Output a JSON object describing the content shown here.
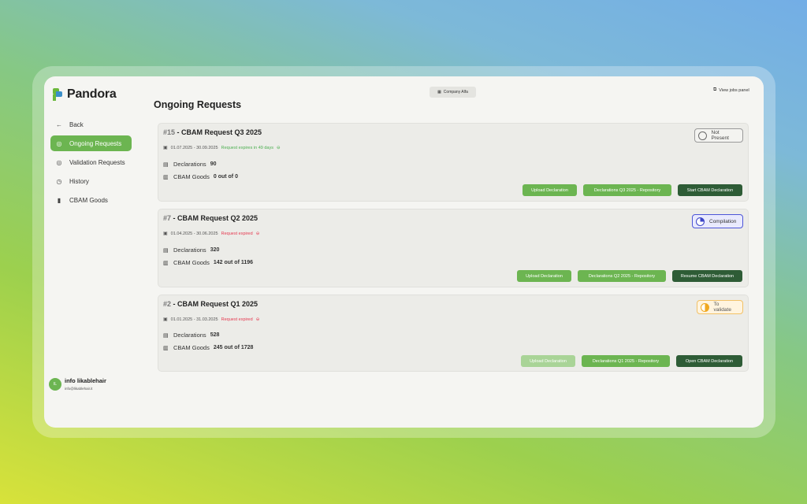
{
  "app": {
    "name": "Pandora"
  },
  "sidebar": {
    "items": [
      {
        "label": "Back",
        "icon": "arrow-left-icon",
        "active": false
      },
      {
        "label": "Ongoing Requests",
        "icon": "check-circle-icon",
        "active": true
      },
      {
        "label": "Validation Requests",
        "icon": "check-circle-icon",
        "active": false
      },
      {
        "label": "History",
        "icon": "history-icon",
        "active": false
      },
      {
        "label": "CBAM Goods",
        "icon": "book-icon",
        "active": false
      }
    ]
  },
  "user": {
    "initials": "IL",
    "name": "info likablehair",
    "email": "info@likablehair.it"
  },
  "header": {
    "company_button": "Company Alfa",
    "view_jobs": "View jobs panel"
  },
  "page": {
    "title": "Ongoing Requests"
  },
  "requests": [
    {
      "number": "#15",
      "title": "CBAM Request Q3 2025",
      "dates": "01.07.2025 - 30.09.2025",
      "expiry": "Request expires in 49 days",
      "expiry_color": "#4caf50",
      "declarations_label": "Declarations",
      "declarations": "90",
      "goods_label": "CBAM Goods",
      "goods": "0 out of 0",
      "status": "Not Present",
      "status_color": "#666666",
      "actions": [
        {
          "label": "Upload Declaration"
        },
        {
          "label": "Declarations Q3 2025 - Repository"
        },
        {
          "label": "Start CBAM Declaration"
        }
      ]
    },
    {
      "number": "#7",
      "title": "CBAM Request Q2 2025",
      "dates": "01.04.2025 - 30.06.2025",
      "expiry": "Request expired",
      "expiry_color": "#e53950",
      "declarations_label": "Declarations",
      "declarations": "320",
      "goods_label": "CBAM Goods",
      "goods": "142 out of 1196",
      "status": "Compilation",
      "status_color": "#3d45c8",
      "actions": [
        {
          "label": "Upload Declaration"
        },
        {
          "label": "Declarations Q2 2025 - Repository"
        },
        {
          "label": "Resume CBAM Declaration"
        }
      ]
    },
    {
      "number": "#2",
      "title": "CBAM Request Q1 2025",
      "dates": "01.01.2025 - 31.03.2025",
      "expiry": "Request expired",
      "expiry_color": "#e53950",
      "declarations_label": "Declarations",
      "declarations": "528",
      "goods_label": "CBAM Goods",
      "goods": "245 out of 1728",
      "status": "To validate",
      "status_color": "#f0a820",
      "actions": [
        {
          "label": "Upload Declaration",
          "disabled": true
        },
        {
          "label": "Declarations Q1 2025 - Repository"
        },
        {
          "label": "Open CBAM Declaration"
        }
      ]
    }
  ],
  "colors": {
    "accent": "#6cb551",
    "primary_dark": "#2e5c36",
    "window_bg": "#f5f5f2"
  }
}
